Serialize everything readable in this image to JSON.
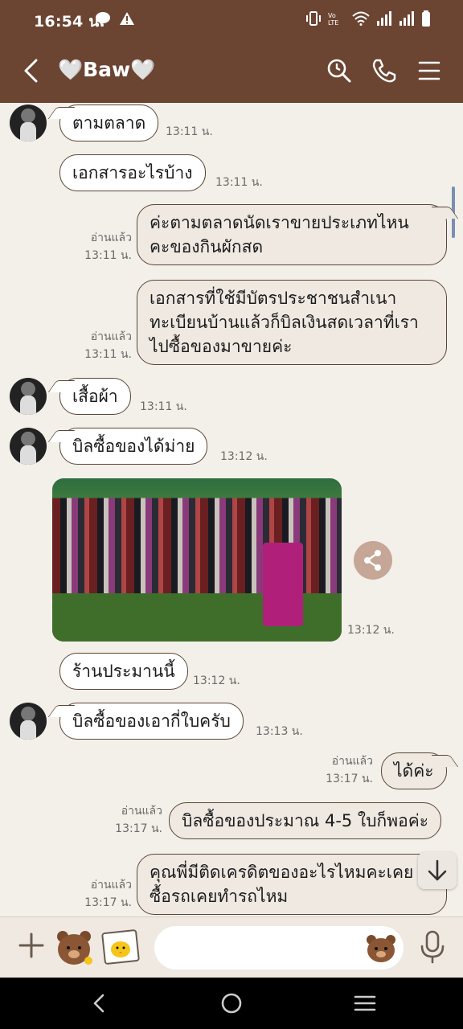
{
  "status_bar": {
    "time": "16:54 น.",
    "notification_icons": [
      "line-app-icon",
      "warning-icon"
    ],
    "system_icons": [
      "vibrate-icon",
      "volte-icon",
      "wifi-icon",
      "signal-icon",
      "signal-icon",
      "battery-icon"
    ]
  },
  "header": {
    "title": "🤍Baw🤍",
    "actions": [
      "search-icon",
      "phone-icon",
      "menu-icon"
    ]
  },
  "messages": [
    {
      "side": "in",
      "text": "ตามตลาด",
      "time": "13:11 น."
    },
    {
      "side": "in",
      "text": "เอกสารอะไรบ้าง",
      "time": "13:11 น."
    },
    {
      "side": "out",
      "text": "ค่ะตามตลาดนัดเราขายประเภทไหน คะของกินผักสด",
      "read": "อ่านแล้ว",
      "time": "13:11 น."
    },
    {
      "side": "out",
      "text": "เอกสารที่ใช้มีบัตรประชาชนสำเนาทะเบียนบ้านแล้วก็บิลเงินสดเวลาที่เราไปซื้อของมาขายค่ะ",
      "read": "อ่านแล้ว",
      "time": "13:11 น."
    },
    {
      "side": "in",
      "text": "เสื้อผ้า",
      "time": "13:11 น."
    },
    {
      "side": "in",
      "text": "บิลซื้อของได้ม่าย",
      "time": "13:12 น."
    },
    {
      "side": "in",
      "type": "photo",
      "time": "13:12 น."
    },
    {
      "side": "in",
      "text": "ร้านประมานนี้",
      "time": "13:12 น."
    },
    {
      "side": "in",
      "text": "บิลซื้อของเอากี่ใบครับ",
      "time": "13:13 น."
    },
    {
      "side": "out",
      "text": "ได้ค่ะ",
      "read": "อ่านแล้ว",
      "time": "13:17 น."
    },
    {
      "side": "out",
      "text": "บิลซื้อของประมาณ 4-5 ใบก็พอค่ะ",
      "read": "อ่านแล้ว",
      "time": "13:17 น."
    },
    {
      "side": "out",
      "text": "คุณพี่มีติดเครดิตของอะไรไหมคะเคยซื้อรถเคยทำรถไหม",
      "read": "อ่านแล้ว",
      "time": "13:17 น."
    }
  ],
  "input": {
    "placeholder": ""
  },
  "nav": [
    "back-icon",
    "home-icon",
    "recents-icon"
  ]
}
